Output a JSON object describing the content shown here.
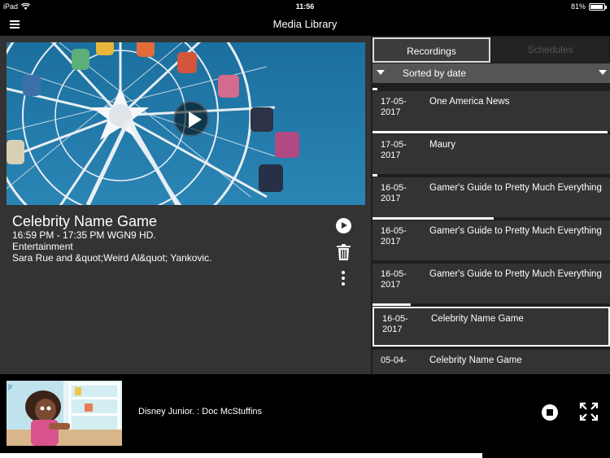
{
  "status_bar": {
    "device": "iPad",
    "time": "11:56",
    "battery": "81%",
    "battery_level": 0.81
  },
  "nav": {
    "title": "Media Library"
  },
  "detail": {
    "title": "Celebrity Name Game",
    "time_channel": "16:59 PM - 17:35 PM  WGN9 HD.",
    "genre": "Entertainment",
    "description": "Sara Rue and &quot;Weird Al&quot; Yankovic."
  },
  "tabs": {
    "recordings": "Recordings",
    "schedules": "Schedules"
  },
  "sort": {
    "label": "Sorted by date"
  },
  "recordings": [
    {
      "date": "17-05-2017",
      "name": "One America News",
      "progress": 0.02
    },
    {
      "date": "17-05-2017",
      "name": "Maury",
      "progress": 0.99
    },
    {
      "date": "16-05-2017",
      "name": "Gamer's Guide to Pretty Much Everything",
      "progress": 0.02
    },
    {
      "date": "16-05-2017",
      "name": "Gamer's Guide to Pretty Much Everything",
      "progress": 0.51
    },
    {
      "date": "16-05-2017",
      "name": "Gamer's Guide to Pretty Much Everything",
      "progress": 0
    },
    {
      "date": "16-05-2017",
      "name": "Celebrity Name Game",
      "progress": 0.16,
      "selected": true
    },
    {
      "date": "05-04-",
      "name": "Celebrity Name Game",
      "progress": 0
    }
  ],
  "mini_player": {
    "title": "Disney Junior. : Doc McStuffins",
    "progress": 0.79
  },
  "colors": {
    "panel": "#333333",
    "list_bg": "#1e1e1e",
    "sort_bar": "#555555"
  }
}
